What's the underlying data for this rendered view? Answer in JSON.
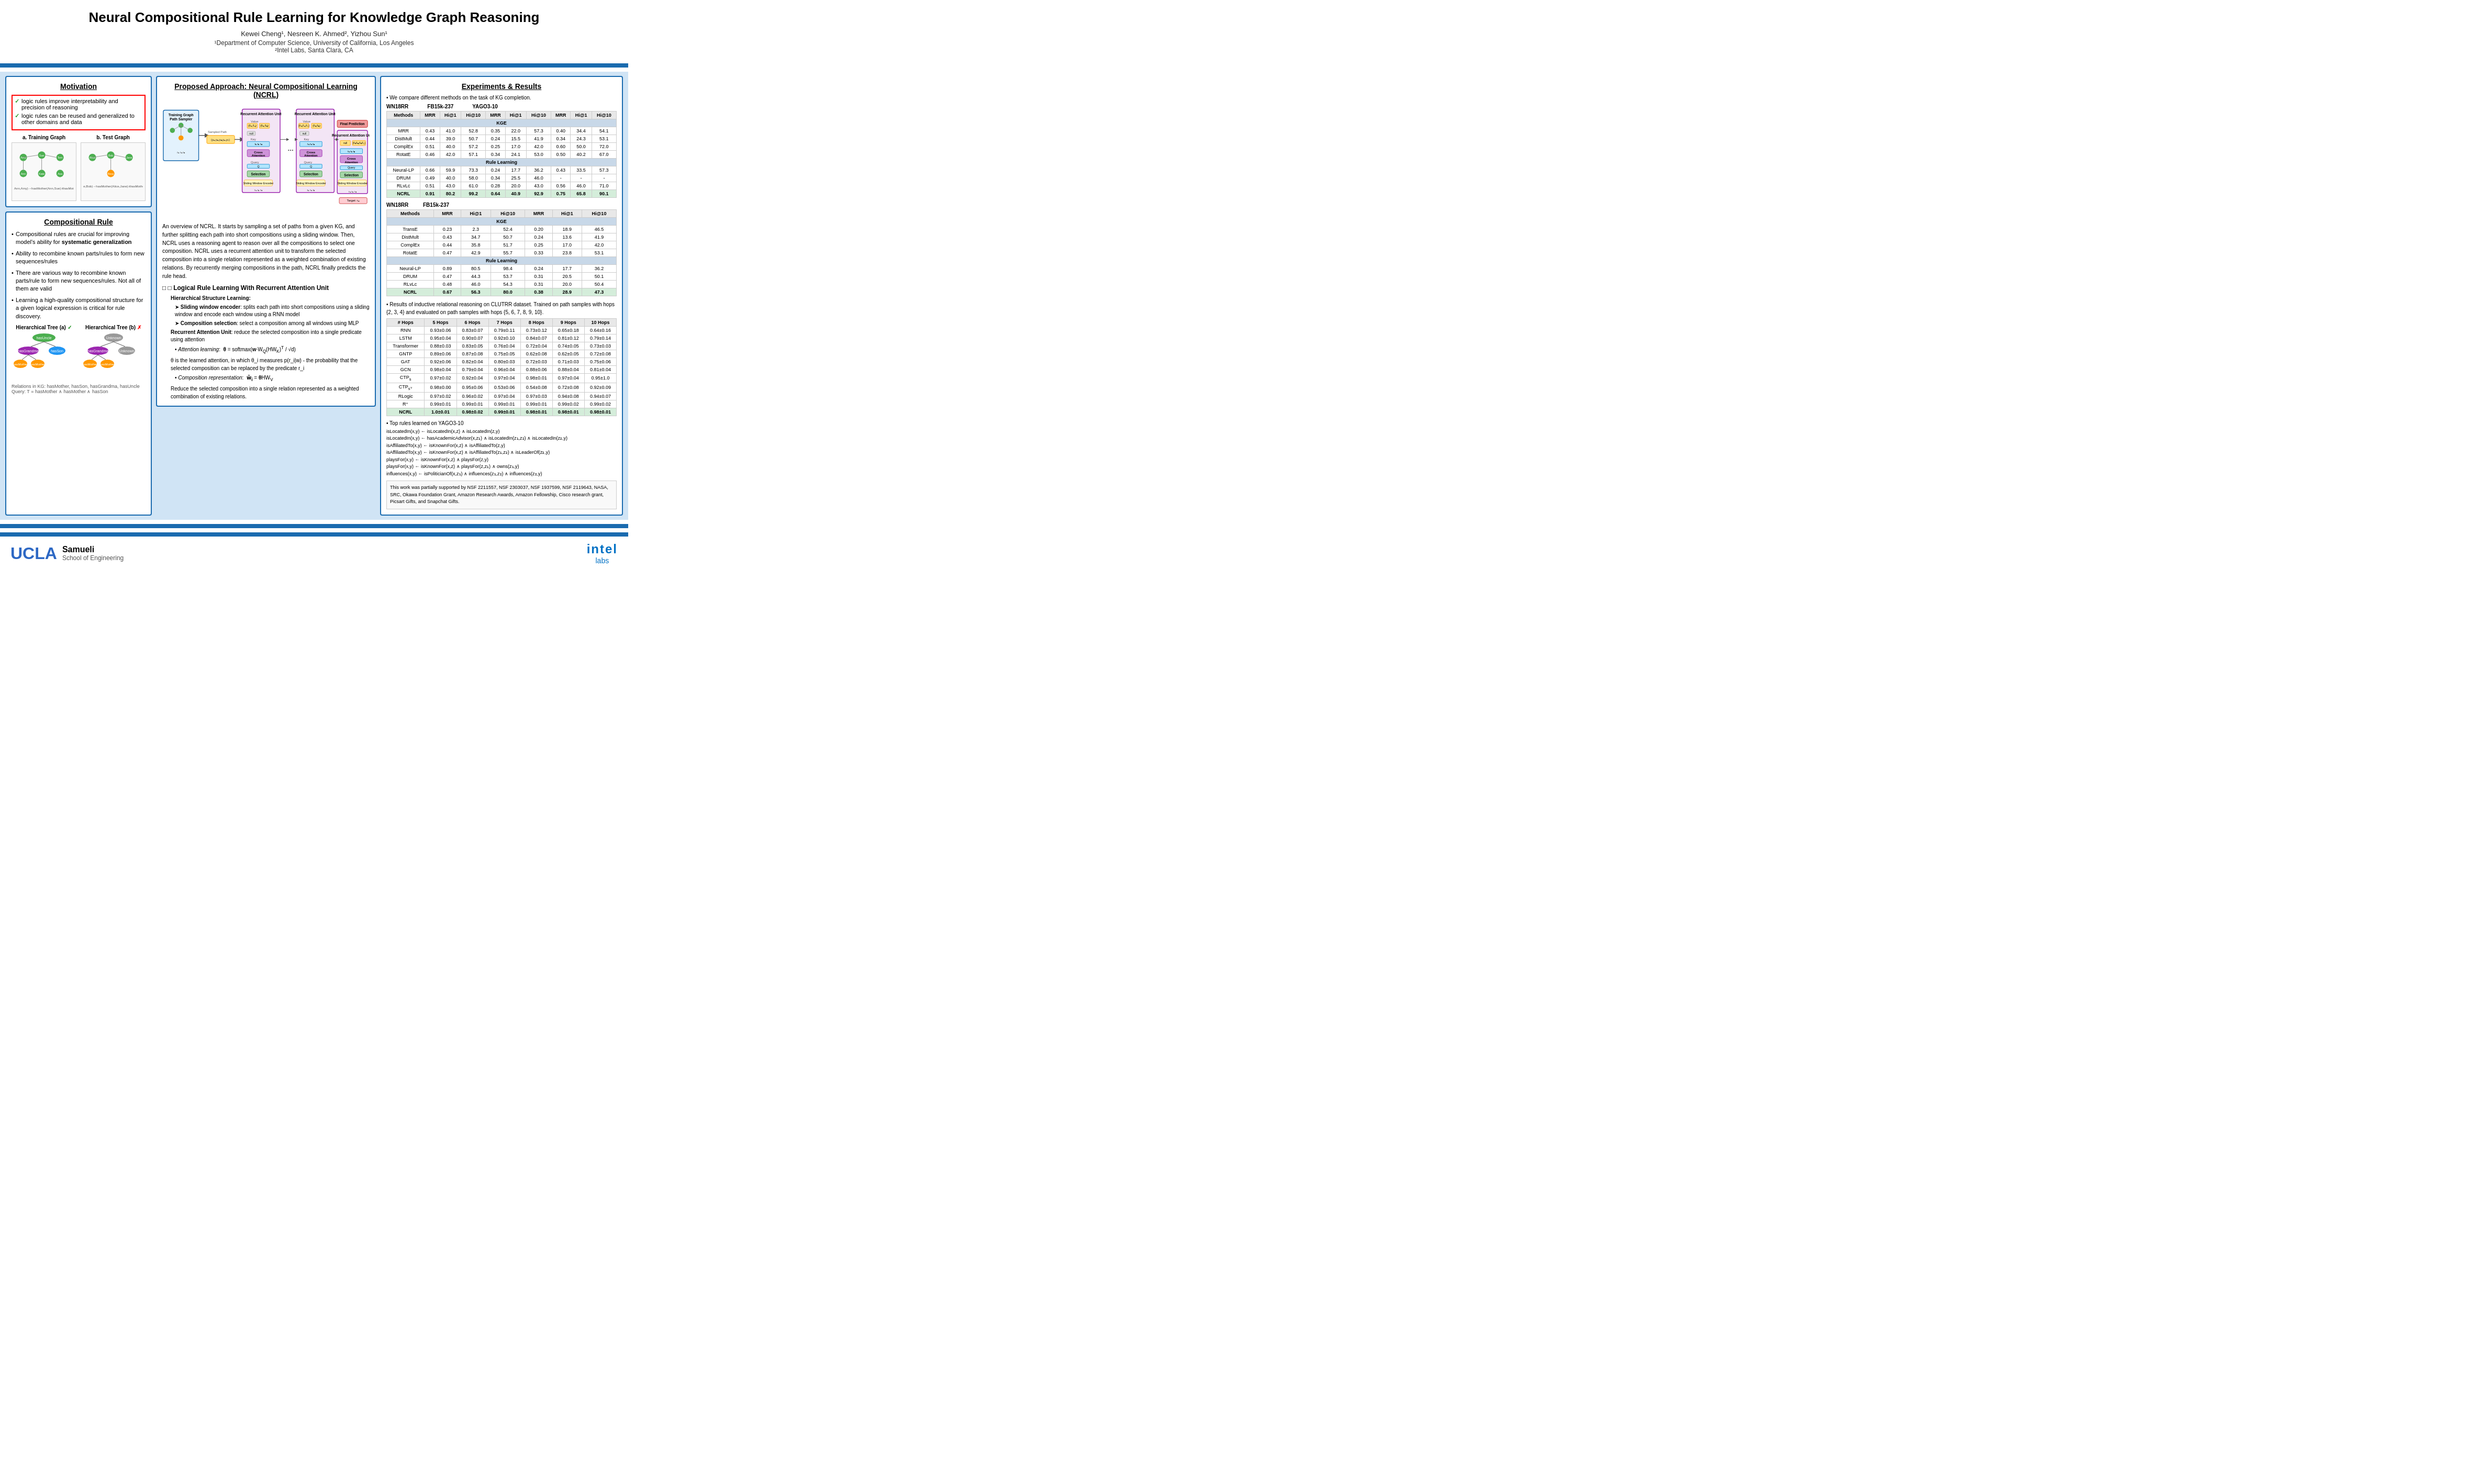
{
  "header": {
    "title": "Neural Compositional Rule Learning for Knowledge Graph Reasoning",
    "authors": "Kewei Cheng¹, Nesreen K. Ahmed², Yizhou Sun¹",
    "affiliation1": "¹Department of Computer Science, University of California, Los Angeles",
    "affiliation2": "²Intel Labs, Santa Clara, CA"
  },
  "left_panel": {
    "motivation_title": "Motivation",
    "motivation_items": [
      "logic rules improve interpretability and precision of reasoning",
      "logic rules can be reused and generalized to other domains and data"
    ],
    "graph_a_label": "a. Training Graph",
    "graph_b_label": "b. Test Graph",
    "comp_rule_title": "Compositional Rule",
    "comp_rule_items": [
      "Compositional rules are crucial for improving model's ability for systematic generalization",
      "Ability to recombine known parts/rules to form new sequences/rules",
      "There are various way to recombine known parts/rule to form new sequences/rules. Not all of them are valid",
      "Learning a high-quality compositional structure for a given logical expression is critical for rule discovery."
    ],
    "tree_a_title": "Hierarchical Tree (a) ✓",
    "tree_b_title": "Hierarchical Tree (b) ✗",
    "tree_footer": "Relations in KG: hasMother, hasSon, hasGrandma, hasUncle\nQuery: T = hasMother ∧ hasMother ∧ hasSon"
  },
  "middle_panel": {
    "approach_title": "Proposed Approach: Neural Compositional Learning (NCRL)",
    "arch_description": "An overview of NCRL. It starts by sampling a set of paths from a given KG, and further splitting each path into short compositions using a sliding window. Then, NCRL uses a reasoning agent to reason over all the compositions to select one composition. NCRL uses a recurrent attention unit to transform the selected composition into a single relation represented as a weighted combination of existing relations. By recurrently merging compositions in the path, NCRL finally predicts the rule head.",
    "logical_rule_title": "□ Logical Rule Learning With Recurrent Attention Unit",
    "hierarchical_title": "Hierarchical Structure Learning:",
    "sliding_window_desc": "Sliding window encoder: splits each path into short compositions using a sliding window and encode each window using a RNN model",
    "comp_selection_desc": "Composition selection: select a composition among all windows using MLP",
    "recurrent_title": "Recurrent Attention Unit: reduce the selected composition into a single predicate using attention",
    "attention_formula": "θ = softmax(w·W_Q(HW_K)^T / √d)",
    "attention_desc": "θ is the learned attention, in which θ_i measures p(r_i|w) - the probability that the selected composition can be replaced by the predicate r_i",
    "comp_repr_label": "Composition representation:",
    "comp_repr_formula": "w̃_i = θHW_V",
    "comp_repr_desc": "Reduce the selected composition into a single relation represented as a weighted combination of existing relations."
  },
  "right_panel": {
    "results_title": "Experiments & Results",
    "compare_text": "We compare different methods on the task of KG completion.",
    "table1_sections": {
      "kge_label": "KGE",
      "rule_learning_label": "Rule Learning",
      "methods_wn18rr": [
        "TransE",
        "DistMult",
        "ComplEx",
        "RotatE",
        "Neural-LP",
        "DRUM",
        "RLvLc",
        "NCRL"
      ],
      "cols": [
        "MRR",
        "Hi@1",
        "Hi@10"
      ]
    },
    "inductive_text": "Results of inductive relational reasoning on CLUTRR dataset. Trained on path samples with hops {2, 3, 4} and evaluated on path samples with hops {5, 6, 7, 8, 9, 10}.",
    "top_rules_text": "Top rules learned on YAGO3-10",
    "support_text": "This work was partially supported by NSF 2211557, NSF 2303037, NSF 1937599, NSF 2119643, NASA, SRC, Okawa Foundation Grant, Amazon Research Awards, Amazon Fellowship, Cisco research grant, Picsart Gifts, and Snapchat Gifts."
  },
  "footer": {
    "ucla_main": "UCLA",
    "samueli_title": "Samueli",
    "samueli_sub": "School of Engineering",
    "intel_main": "intel",
    "intel_sub": "labs"
  }
}
